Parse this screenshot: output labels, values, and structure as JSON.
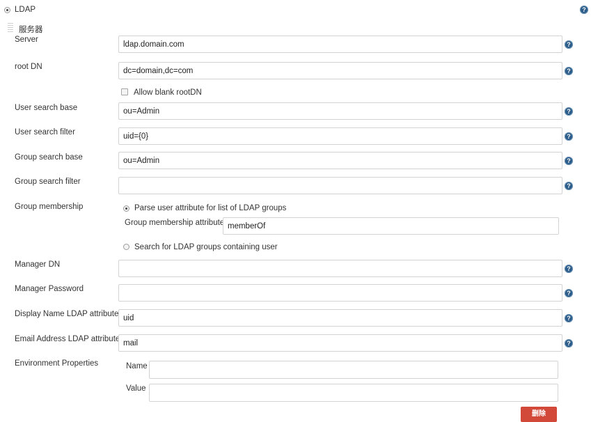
{
  "help_glyph": "?",
  "realm": {
    "option_label": "LDAP",
    "selected": true
  },
  "server_section": {
    "title": "服务器"
  },
  "fields": {
    "server": {
      "label": "Server",
      "value": "ldap.domain.com"
    },
    "root_dn": {
      "label": "root DN",
      "value": "dc=domain,dc=com"
    },
    "allow_blank_rootdn": {
      "label": "Allow blank rootDN",
      "checked": false
    },
    "user_search_base": {
      "label": "User search base",
      "value": "ou=Admin"
    },
    "user_search_filter": {
      "label": "User search filter",
      "value": "uid={0}"
    },
    "group_search_base": {
      "label": "Group search base",
      "value": "ou=Admin"
    },
    "group_search_filter": {
      "label": "Group search filter",
      "value": ""
    },
    "group_membership": {
      "label": "Group membership",
      "option_parse_label": "Parse user attribute for list of LDAP groups",
      "attribute_label": "Group membership attribute",
      "attribute_value": "memberOf",
      "option_search_label": "Search for LDAP groups containing user",
      "selected": "parse"
    },
    "manager_dn": {
      "label": "Manager DN",
      "value": ""
    },
    "manager_password": {
      "label": "Manager Password",
      "value": ""
    },
    "display_name_attr": {
      "label": "Display Name LDAP attribute",
      "value": "uid"
    },
    "email_attr": {
      "label": "Email Address LDAP attribute",
      "value": "mail"
    },
    "environment_properties": {
      "label": "Environment Properties",
      "name_label": "Name",
      "name_value": "",
      "value_label": "Value",
      "value_value": ""
    }
  },
  "delete_button": {
    "label": "删除"
  },
  "colors": {
    "help_icon": "#2b5c8a",
    "delete_button": "#d24939",
    "field_border": "#d3d3d3"
  }
}
